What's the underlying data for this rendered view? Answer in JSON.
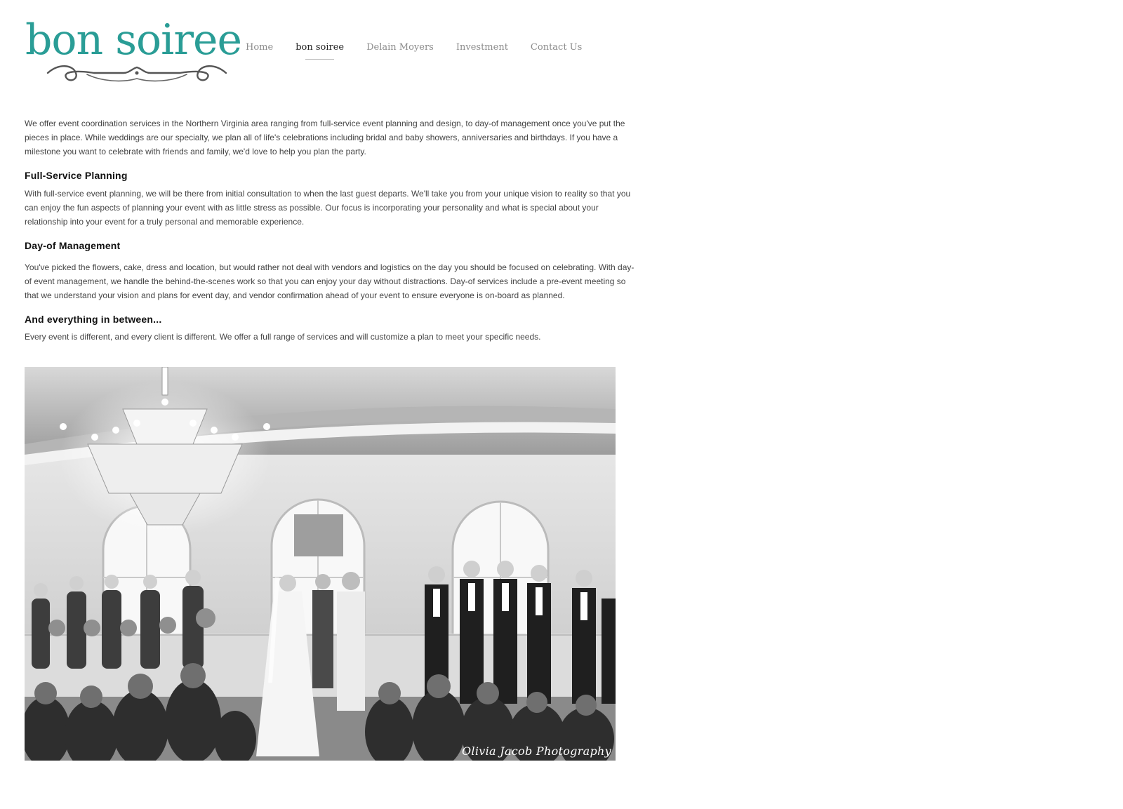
{
  "brand": {
    "logo_text": "bon soiree"
  },
  "nav": {
    "items": [
      {
        "label": "Home",
        "active": false
      },
      {
        "label": "bon soiree",
        "active": true
      },
      {
        "label": "Delain Moyers",
        "active": false
      },
      {
        "label": "Investment",
        "active": false
      },
      {
        "label": "Contact Us",
        "active": false
      }
    ]
  },
  "content": {
    "intro": "We offer event coordination services in the Northern Virginia area ranging from full-service event planning and design, to day-of management once you've put the pieces in place. While weddings are our specialty, we plan all of life's celebrations including bridal and baby showers, anniversaries and birthdays. If you have a milestone you want to celebrate with friends and family, we'd love to help you plan the party.",
    "sections": [
      {
        "heading": "Full-Service Planning",
        "body": "With full-service event planning, we will be there from initial consultation to when the last guest departs. We'll take you from your unique vision to reality so that you can enjoy the fun aspects of planning your event with as little stress as possible. Our focus is incorporating  your personality and what is special about your relationship into your event for a truly personal and memorable experience."
      },
      {
        "heading": "Day-of Management",
        "body": "You've picked the flowers, cake, dress and location, but would rather not deal with vendors and logistics on the day you should be focused on celebrating.  With day-of event management, we handle the behind-the-scenes work so that you can enjoy your day without distractions. Day-of services include a pre-event meeting so that we understand your vision and plans for event day, and vendor confirmation ahead of your event to ensure everyone is on-board as planned."
      },
      {
        "heading": "And everything in between...",
        "body": "Every event is different, and every client is different.  We offer a full range of services and will customize a plan to meet your specific needs."
      }
    ]
  },
  "photo": {
    "credit": "Olivia Jacob Photography",
    "subject": "black and white wedding ceremony under a chandelier"
  },
  "colors": {
    "brand_teal": "#2a9d96",
    "text": "#444444",
    "nav_inactive": "#8c8c8c",
    "nav_active": "#222222"
  }
}
